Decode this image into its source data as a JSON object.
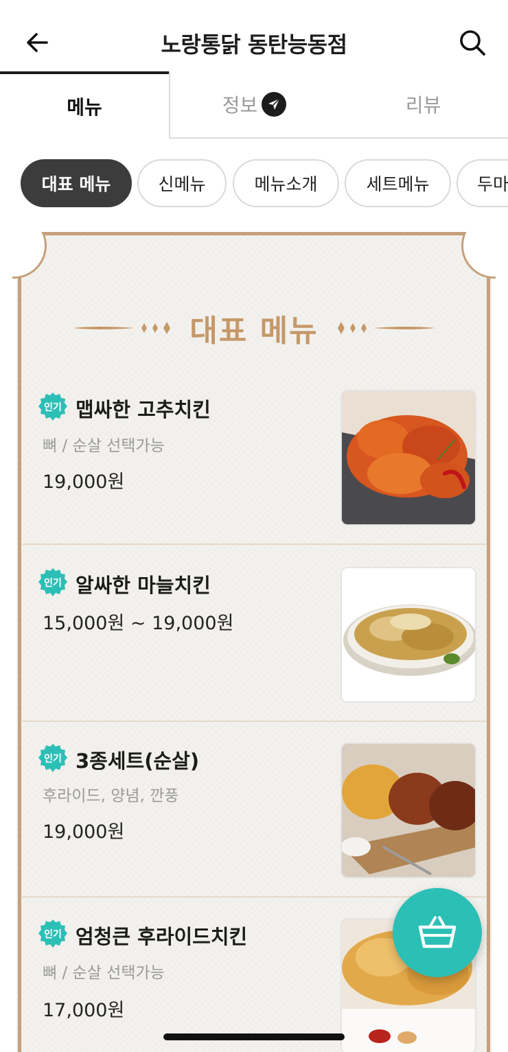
{
  "header": {
    "title": "노랑통닭 동탄능동점"
  },
  "tabs": [
    {
      "label": "메뉴"
    },
    {
      "label": "정보"
    },
    {
      "label": "리뷰"
    }
  ],
  "chips": [
    {
      "label": "대표 메뉴"
    },
    {
      "label": "신메뉴"
    },
    {
      "label": "메뉴소개"
    },
    {
      "label": "세트메뉴"
    },
    {
      "label": "두마"
    }
  ],
  "section": {
    "title": "대표 메뉴"
  },
  "items": [
    {
      "badge": "인기",
      "name": "맵싸한 고추치킨",
      "desc": "뼈 / 순살 선택가능",
      "price": "19,000원"
    },
    {
      "badge": "인기",
      "name": "알싸한 마늘치킨",
      "desc": "",
      "price": "15,000원 ~ 19,000원"
    },
    {
      "badge": "인기",
      "name": "3종세트(순살)",
      "desc": "후라이드, 양념, 깐풍",
      "price": "19,000원"
    },
    {
      "badge": "인기",
      "name": "엄청큰 후라이드치킨",
      "desc": "뼈 / 순살 선택가능",
      "price": "17,000원"
    }
  ],
  "icons": {
    "back": "arrow-left-icon",
    "search": "search-icon",
    "info_badge": "send-icon",
    "cart": "basket-icon"
  },
  "colors": {
    "accent": "#2cbfb6",
    "gold": "#c59869",
    "dark_chip": "#3c3c3c"
  }
}
